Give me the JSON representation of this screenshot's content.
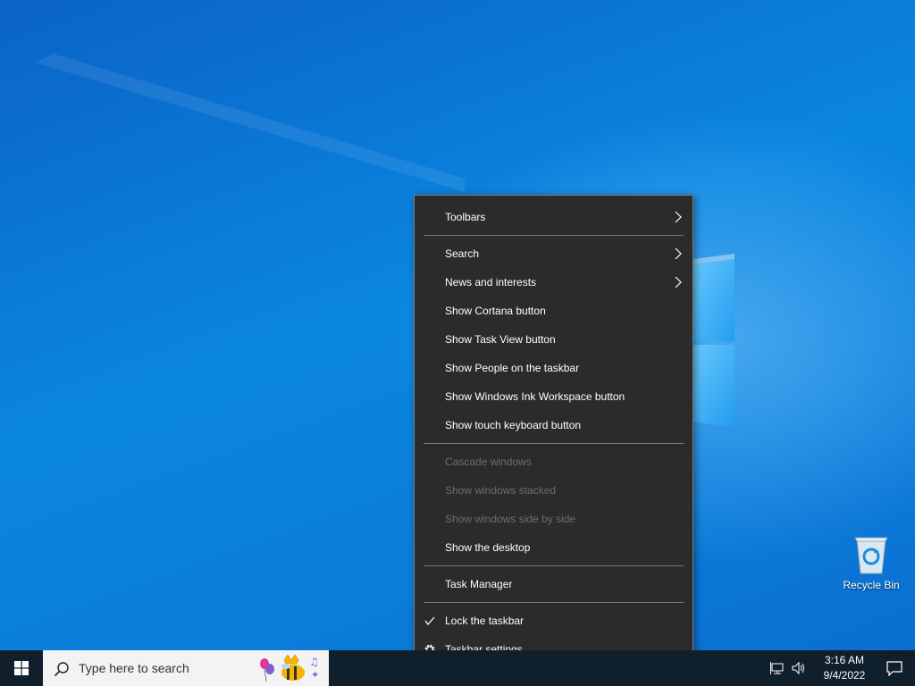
{
  "desktop": {
    "recycle_bin_label": "Recycle Bin"
  },
  "context_menu": {
    "items": [
      {
        "label": "Toolbars",
        "submenu": true,
        "disabled": false
      },
      {
        "label": "Search",
        "submenu": true,
        "disabled": false
      },
      {
        "label": "News and interests",
        "submenu": true,
        "disabled": false
      },
      {
        "label": "Show Cortana button",
        "disabled": false
      },
      {
        "label": "Show Task View button",
        "disabled": false
      },
      {
        "label": "Show People on the taskbar",
        "disabled": false
      },
      {
        "label": "Show Windows Ink Workspace button",
        "disabled": false
      },
      {
        "label": "Show touch keyboard button",
        "disabled": false
      },
      {
        "label": "Cascade windows",
        "disabled": true
      },
      {
        "label": "Show windows stacked",
        "disabled": true
      },
      {
        "label": "Show windows side by side",
        "disabled": true
      },
      {
        "label": "Show the desktop",
        "disabled": false
      },
      {
        "label": "Task Manager",
        "disabled": false
      },
      {
        "label": "Lock the taskbar",
        "checked": true,
        "disabled": false
      },
      {
        "label": "Taskbar settings",
        "icon": "gear-icon",
        "disabled": false
      }
    ]
  },
  "taskbar": {
    "search_placeholder": "Type here to search",
    "time": "3:16 AM",
    "date": "9/4/2022"
  },
  "colors": {
    "menu_bg": "#2b2b2b",
    "menu_disabled_text": "#6d6d6d",
    "taskbar_bg": "#101f2c",
    "desktop_blue": "#0a78d7"
  }
}
